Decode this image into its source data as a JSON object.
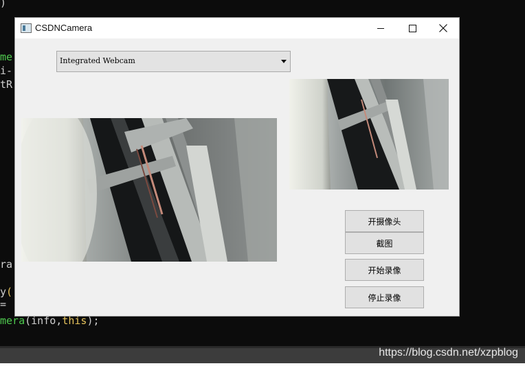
{
  "background_code": {
    "line1": ")",
    "line2a": "me",
    "line3": "i-",
    "line4": "tR",
    "line5": "ra",
    "line6a": "y",
    "line6b": "(",
    "line7": "=",
    "line8_fn": "mera",
    "line8_args": "(info,",
    "line8_this": "this",
    "line8_end": ");"
  },
  "window": {
    "title": "CSDNCamera",
    "camera_select": {
      "selected": "Integrated Webcam"
    },
    "buttons": {
      "open_camera": "开摄像头",
      "screenshot": "截图",
      "start_record": "开始录像",
      "stop_record": "停止录像"
    }
  },
  "statusbar": {
    "watermark": "https://blog.csdn.net/xzpblog"
  },
  "colors": {
    "code_green": "#4ec94e",
    "code_yellow": "#e6c35c",
    "window_bg": "#f0f0f0",
    "button_bg": "#e1e1e1"
  }
}
